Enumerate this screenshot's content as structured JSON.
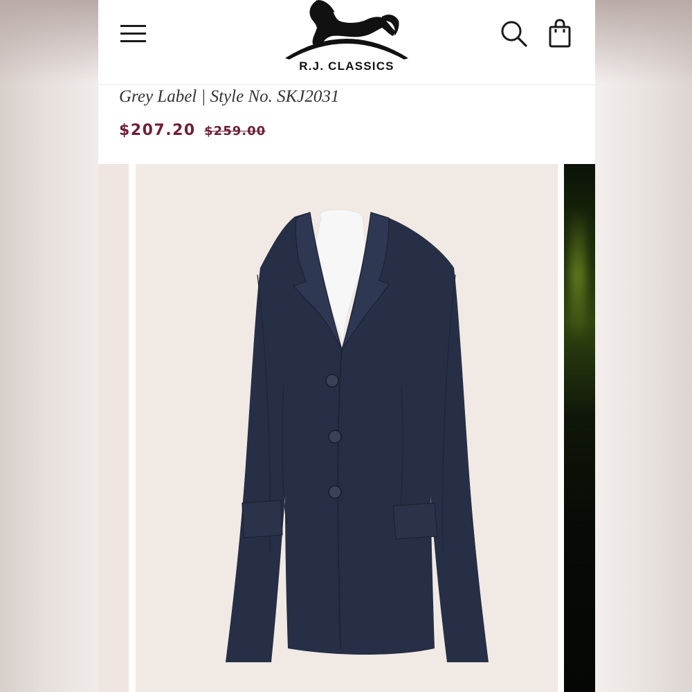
{
  "header": {
    "brand": "R.J. CLASSICS",
    "menu_icon": "hamburger-menu-icon",
    "search_icon": "search-icon",
    "bag_icon": "shopping-bag-icon"
  },
  "product": {
    "subtitle": "Grey Label | Style No. SKJ2031",
    "price": "$207.20",
    "original_price": "$259.00",
    "price_color": "#6e1f3a",
    "jacket_color": "#262f45"
  }
}
